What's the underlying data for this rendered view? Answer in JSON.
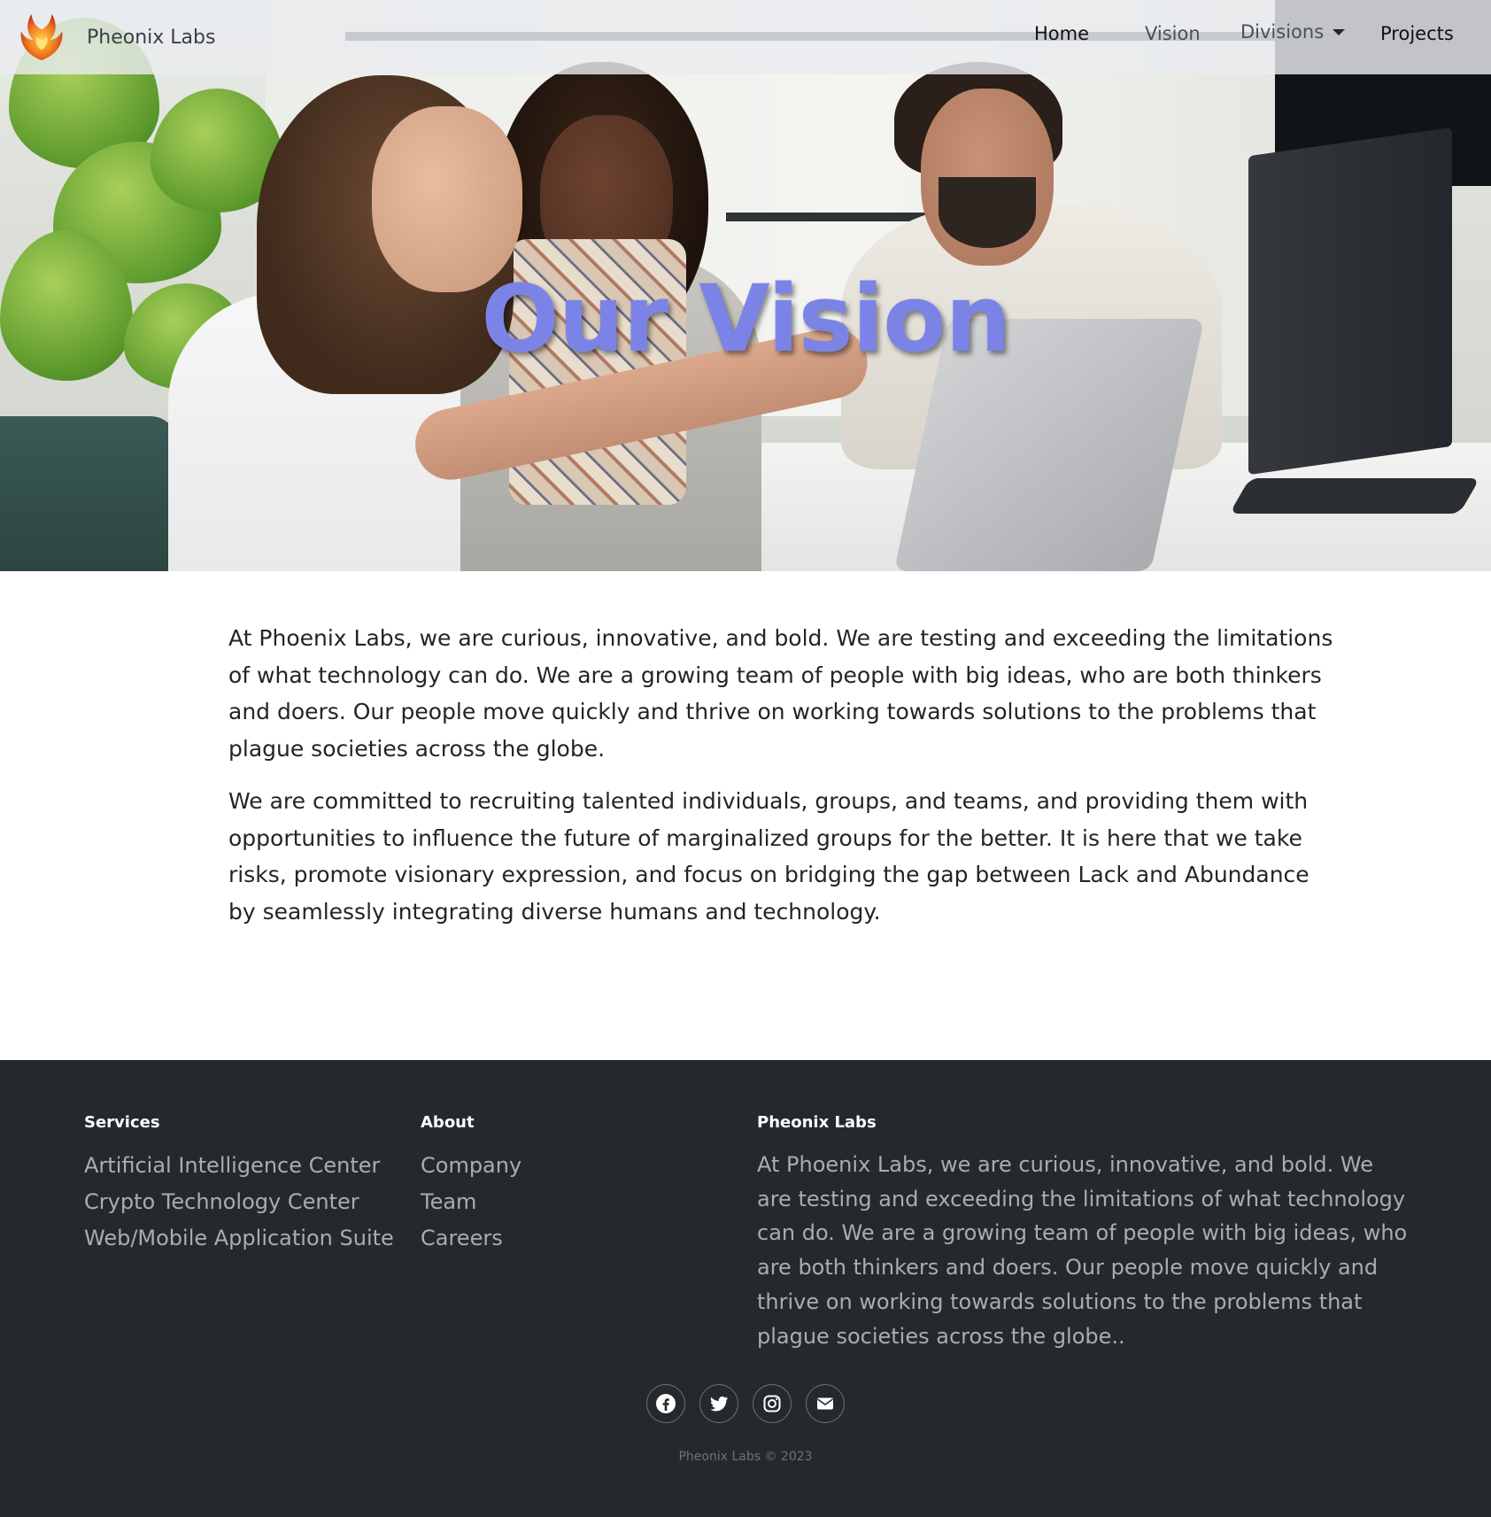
{
  "nav": {
    "brand": "Pheonix Labs",
    "links": {
      "home": "Home",
      "vision": "Vision",
      "divisions": "Divisions",
      "projects": "Projects"
    }
  },
  "hero": {
    "title": "Our Vision"
  },
  "content": {
    "paragraphs": [
      "At Phoenix Labs, we are curious, innovative, and bold. We are testing and exceeding the limitations of what technology can do. We are a growing team of people with big ideas, who are both thinkers and doers. Our people move quickly and thrive on working towards solutions to the problems that plague societies across the globe.",
      "We are committed to recruiting talented individuals, groups, and teams, and providing them with opportunities to influence the future of marginalized groups for the better. It is here that we take risks, promote visionary expression, and focus on bridging the gap between Lack and Abundance by seamlessly integrating diverse humans and technology."
    ]
  },
  "footer": {
    "services": {
      "heading": "Services",
      "links": [
        "Artificial Intelligence Center",
        "Crypto Technology Center",
        "Web/Mobile Application Suite"
      ]
    },
    "about": {
      "heading": "About",
      "links": [
        "Company",
        "Team",
        "Careers"
      ]
    },
    "brand": {
      "heading": "Pheonix Labs",
      "description": "At Phoenix Labs, we are curious, innovative, and bold. We are testing and exceeding the limitations of what technology can do. We are a growing team of people with big ideas, who are both thinkers and doers. Our people move quickly and thrive on working towards solutions to the problems that plague societies across the globe.."
    },
    "socials": [
      "facebook-icon",
      "twitter-icon",
      "instagram-icon",
      "email-icon"
    ],
    "copyright": "Pheonix Labs © 2023"
  },
  "colors": {
    "hero_title": "#7b84e6",
    "footer_bg": "#24292e",
    "footer_text": "#a9adb1"
  }
}
